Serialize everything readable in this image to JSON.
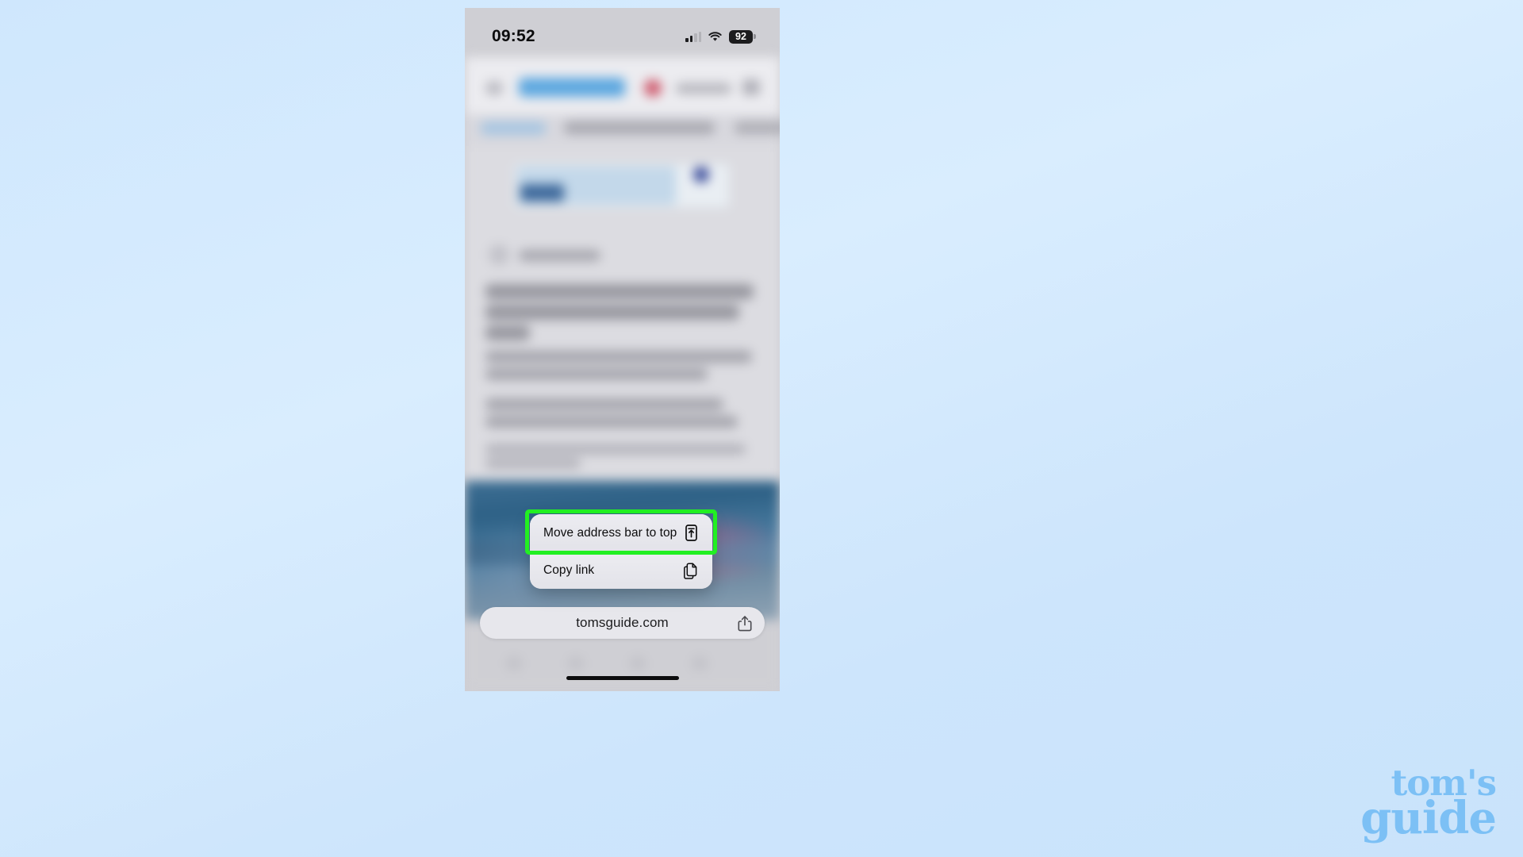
{
  "background": {
    "gradient_from": "#cfe7fd",
    "gradient_to": "#c9e3fb"
  },
  "phone": {
    "status_bar": {
      "time": "09:52",
      "cellular_icon": "cellular-signal-icon",
      "cellular_bars_filled": 2,
      "cellular_bars_total": 4,
      "wifi_icon": "wifi-icon",
      "battery_icon": "battery-icon",
      "battery_percent": "92"
    },
    "browser": {
      "address_bar": {
        "url": "tomsguide.com",
        "share_icon": "share-icon"
      },
      "home_indicator": "home-indicator"
    },
    "context_menu": {
      "items": [
        {
          "label": "Move address bar to top",
          "icon": "phone-arrow-up-icon",
          "highlighted": true
        },
        {
          "label": "Copy link",
          "icon": "copy-documents-icon",
          "highlighted": false
        }
      ],
      "highlight_color": "#22ef22"
    }
  },
  "watermark": {
    "line1": "tom's",
    "line2": "guide",
    "color": "#7cc0f5"
  }
}
